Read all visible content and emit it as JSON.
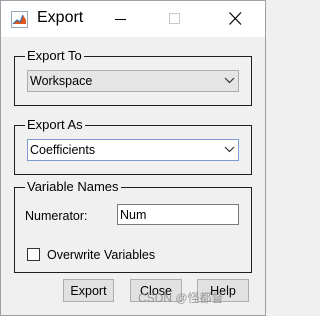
{
  "window": {
    "title": "Export",
    "icon": "matlab-icon",
    "controls": {
      "minimize": "minimize-icon",
      "maximize": "maximize-icon",
      "close": "close-icon"
    }
  },
  "export_to": {
    "label": "Export To",
    "selected": "Workspace"
  },
  "export_as": {
    "label": "Export As",
    "selected": "Coefficients"
  },
  "variable_names": {
    "label": "Variable Names",
    "numerator_label": "Numerator:",
    "numerator_value": "Num",
    "overwrite_label": "Overwrite Variables",
    "overwrite_checked": false
  },
  "buttons": {
    "export": "Export",
    "close": "Close",
    "help": "Help"
  },
  "watermark": "CSDN @怪都督",
  "colors": {
    "title_bar": "#ffffff",
    "dialog_bg": "#f0f0f0",
    "focus_border": "#7a9cd3"
  }
}
